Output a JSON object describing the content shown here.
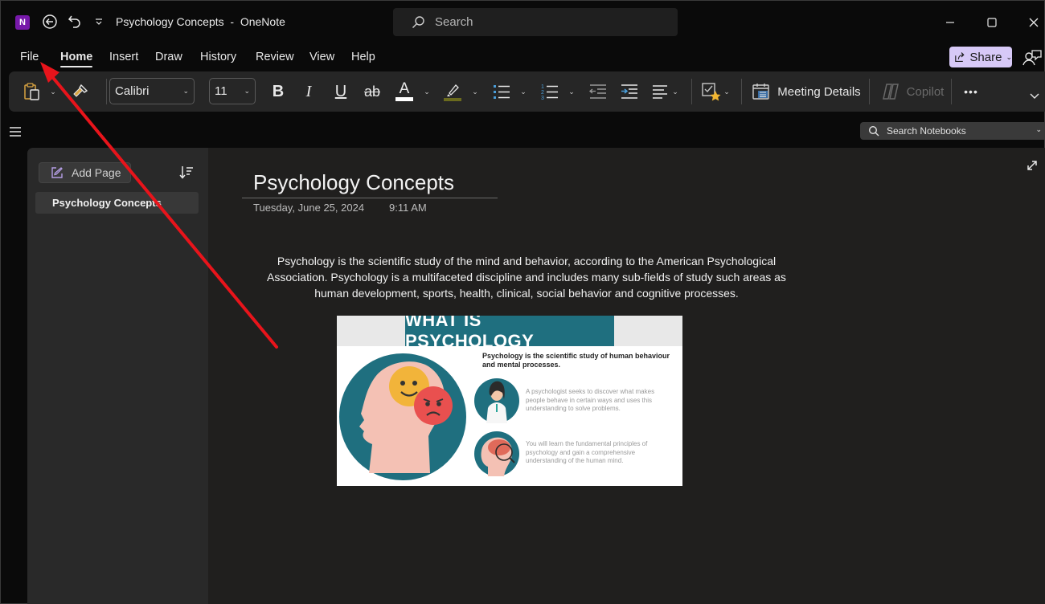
{
  "window": {
    "app_name": "OneNote",
    "title": "Psychology Concepts  -  OneNote",
    "logo_letter": "N",
    "search_placeholder": "Search"
  },
  "menu": {
    "tabs": [
      {
        "label": "File",
        "active": false
      },
      {
        "label": "Home",
        "active": true
      },
      {
        "label": "Insert",
        "active": false
      },
      {
        "label": "Draw",
        "active": false
      },
      {
        "label": "History",
        "active": false
      },
      {
        "label": "Review",
        "active": false
      },
      {
        "label": "View",
        "active": false
      },
      {
        "label": "Help",
        "active": false
      }
    ],
    "share_label": "Share"
  },
  "ribbon": {
    "font_name": "Calibri",
    "font_size": "11",
    "bold": "B",
    "italic": "I",
    "underline": "U",
    "strikethrough": "ab",
    "font_color_glyph": "A",
    "font_color": "#ffffff",
    "highlight_color": "#6b6b1e",
    "meeting_details_label": "Meeting Details",
    "copilot_label": "Copilot",
    "more_label": "•••"
  },
  "navigation": {
    "search_notebooks_label": "Search Notebooks"
  },
  "pages_pane": {
    "add_page_label": "Add Page",
    "pages": [
      {
        "title": "Psychology Concepts",
        "selected": true
      }
    ]
  },
  "page": {
    "title": "Psychology Concepts",
    "date": "Tuesday, June 25, 2024",
    "time": "9:11 AM",
    "body": "Psychology is the scientific study of the mind and behavior, according to the American Psychological Association. Psychology is a multifaceted discipline and includes many sub-fields of study such areas as human development, sports, health, clinical, social behavior and cognitive processes.",
    "infographic": {
      "title": "WHAT IS PSYCHOLOGY",
      "heading": "Psychology is the scientific study of human behaviour and mental processes.",
      "point_1": "A psychologist seeks to discover what makes people behave in certain ways and uses this understanding to solve problems.",
      "point_2": "You will learn the fundamental principles of psychology and gain a comprehensive understanding of the human mind.",
      "teal": "#1f6f7f"
    }
  },
  "colors": {
    "accent_purple": "#7719aa",
    "share_bg": "#d7c9f7",
    "annotation_red": "#e8141b",
    "list_blue": "#4a9eda"
  }
}
